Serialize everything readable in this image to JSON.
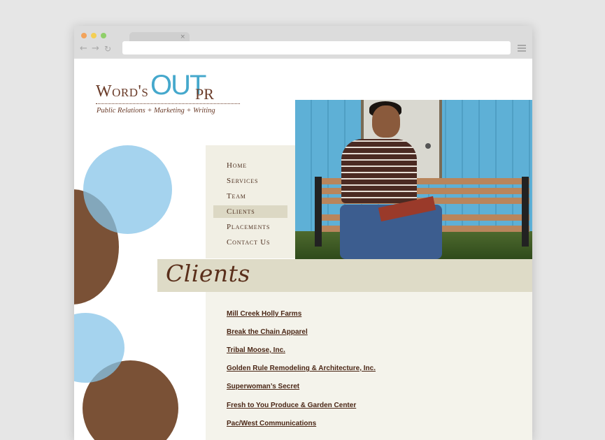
{
  "browser": {
    "tab_close": "×",
    "back_icon": "←",
    "forward_icon": "→",
    "reload_icon": "↻"
  },
  "logo": {
    "words": "Word's",
    "out": "OUT",
    "pr": "PR",
    "tagline": "Public Relations + Marketing + Writing"
  },
  "nav": {
    "items": [
      {
        "label": "Home"
      },
      {
        "label": "Services"
      },
      {
        "label": "Team"
      },
      {
        "label": "Clients",
        "active": true
      },
      {
        "label": "Placements"
      },
      {
        "label": "Contact Us"
      }
    ]
  },
  "page": {
    "title": "Clients"
  },
  "clients": [
    "Mill Creek Holly Farms",
    "Break the Chain Apparel",
    "Tribal Moose, Inc.",
    "Golden Rule Remodeling & Architecture, Inc.",
    "Superwoman’s Secret",
    "Fresh to You Produce & Garden Center",
    "Pac/West Communications"
  ],
  "colors": {
    "brown": "#7a5136",
    "blue": "#45a8cc",
    "light_blue": "#87c4e8",
    "nav_bg": "#f1efe4",
    "title_bg": "#dedbc7",
    "content_bg": "#f4f3eb"
  }
}
